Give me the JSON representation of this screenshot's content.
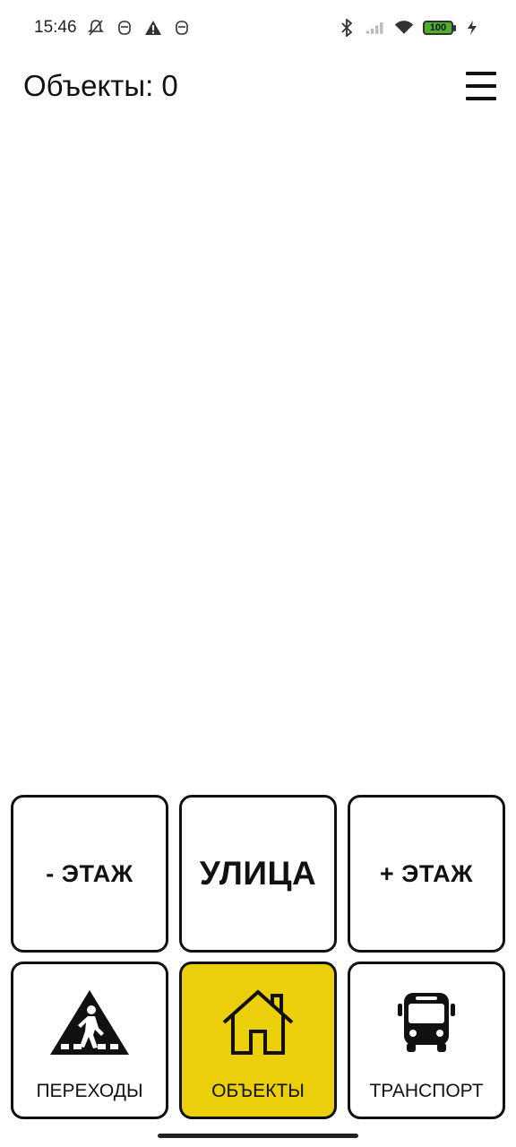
{
  "status_bar": {
    "time": "15:46",
    "battery": "100",
    "icons": [
      "notifications-off-icon",
      "app-notification-icon",
      "warning-icon",
      "app-notification-icon",
      "bluetooth-icon",
      "signal-icon",
      "wifi-icon",
      "battery-icon",
      "charging-icon"
    ]
  },
  "header": {
    "title": "Объекты: 0",
    "menu_icon": "menu-icon"
  },
  "buttons": {
    "floor_down": "- ЭТАЖ",
    "street": "УЛИЦА",
    "floor_up": "+ ЭТАЖ"
  },
  "nav": {
    "crossings": {
      "label": "ПЕРЕХОДЫ",
      "icon": "pedestrian-crossing-icon"
    },
    "objects": {
      "label": "ОБЪЕКТЫ",
      "icon": "house-icon",
      "active": true
    },
    "transport": {
      "label": "ТРАНСПОРТ",
      "icon": "bus-icon"
    }
  },
  "colors": {
    "active_tile": "#ebcf0a",
    "tile_border": "#111111",
    "background": "#ffffff"
  }
}
